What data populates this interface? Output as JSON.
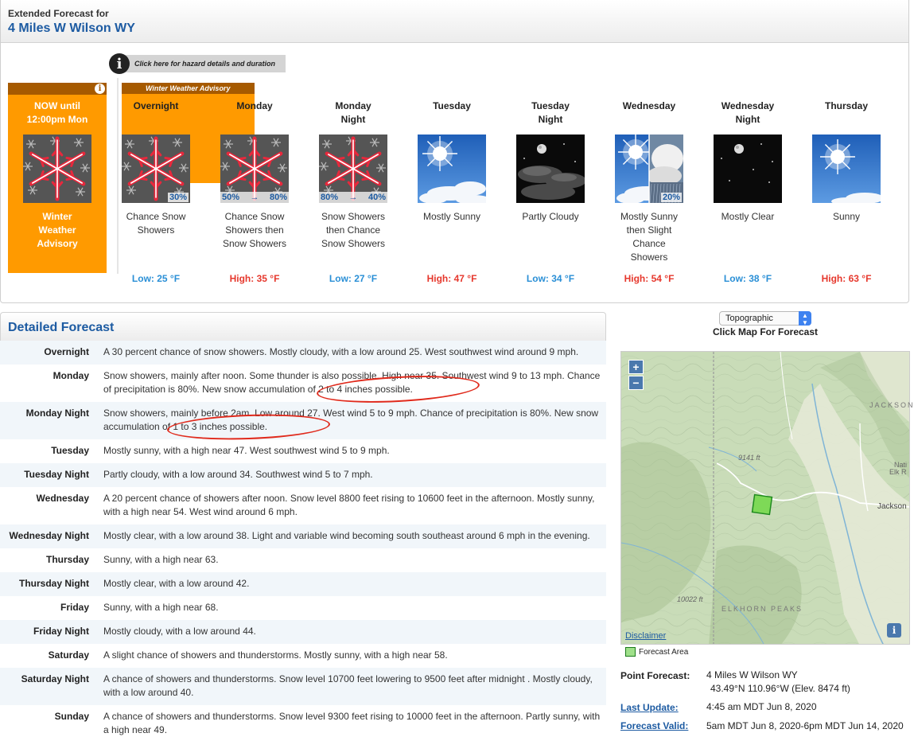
{
  "extended": {
    "title_small": "Extended Forecast for",
    "location": "4 Miles W Wilson WY",
    "hazard_link": "Click here for hazard details and duration",
    "hazard_icon": "info-icon",
    "now_label": "NOW until\n12:00pm Mon",
    "now_advisory": "Winter\nWeather\nAdvisory",
    "band_label": "Winter Weather Advisory",
    "periods": [
      {
        "name": "Overnight",
        "desc": "Chance Snow\nShowers",
        "temp": "Low: 25 °F",
        "kind": "low",
        "icon": "snow-icon",
        "pop_right": "30%",
        "pop_left": ""
      },
      {
        "name": "Monday",
        "desc": "Chance Snow\nShowers then\nSnow Showers",
        "temp": "High: 35 °F",
        "kind": "high",
        "icon": "snow-icon",
        "pop_left": "50%",
        "pop_right": "80%"
      },
      {
        "name": "Monday\nNight",
        "desc": "Snow Showers\nthen Chance\nSnow Showers",
        "temp": "Low: 27 °F",
        "kind": "low",
        "icon": "snow-icon",
        "pop_left": "80%",
        "pop_right": "40%"
      },
      {
        "name": "Tuesday",
        "desc": "Mostly Sunny",
        "temp": "High: 47 °F",
        "kind": "high",
        "icon": "mostly-sunny-icon",
        "pop_left": "",
        "pop_right": ""
      },
      {
        "name": "Tuesday\nNight",
        "desc": "Partly Cloudy",
        "temp": "Low: 34 °F",
        "kind": "low",
        "icon": "partly-cloudy-night-icon",
        "pop_left": "",
        "pop_right": ""
      },
      {
        "name": "Wednesday",
        "desc": "Mostly Sunny\nthen Slight\nChance\nShowers",
        "temp": "High: 54 °F",
        "kind": "high",
        "icon": "sunny-then-showers-icon",
        "pop_left": "",
        "pop_right": "20%"
      },
      {
        "name": "Wednesday\nNight",
        "desc": "Mostly Clear",
        "temp": "Low: 38 °F",
        "kind": "low",
        "icon": "mostly-clear-night-icon",
        "pop_left": "",
        "pop_right": ""
      },
      {
        "name": "Thursday",
        "desc": "Sunny",
        "temp": "High: 63 °F",
        "kind": "high",
        "icon": "sunny-icon",
        "pop_left": "",
        "pop_right": ""
      }
    ]
  },
  "detailed": {
    "title": "Detailed Forecast",
    "rows": [
      {
        "label": "Overnight",
        "text": "A 30 percent chance of snow showers. Mostly cloudy, with a low around 25. West southwest wind around 9 mph."
      },
      {
        "label": "Monday",
        "text": "Snow showers, mainly after noon. Some thunder is also possible. High near 35. Southwest wind 9 to 13 mph. Chance of precipitation is 80%. New snow accumulation of 2 to 4 inches possible."
      },
      {
        "label": "Monday Night",
        "text": "Snow showers, mainly before 2am. Low around 27. West wind 5 to 9 mph. Chance of precipitation is 80%. New snow accumulation of 1 to 3 inches possible."
      },
      {
        "label": "Tuesday",
        "text": "Mostly sunny, with a high near 47. West southwest wind 5 to 9 mph."
      },
      {
        "label": "Tuesday Night",
        "text": "Partly cloudy, with a low around 34. Southwest wind 5 to 7 mph."
      },
      {
        "label": "Wednesday",
        "text": "A 20 percent chance of showers after noon. Snow level 8800 feet rising to 10600 feet in the afternoon. Mostly sunny, with a high near 54. West wind around 6 mph."
      },
      {
        "label": "Wednesday Night",
        "text": "Mostly clear, with a low around 38. Light and variable wind becoming south southeast around 6 mph in the evening."
      },
      {
        "label": "Thursday",
        "text": "Sunny, with a high near 63."
      },
      {
        "label": "Thursday Night",
        "text": "Mostly clear, with a low around 42."
      },
      {
        "label": "Friday",
        "text": "Sunny, with a high near 68."
      },
      {
        "label": "Friday Night",
        "text": "Mostly cloudy, with a low around 44."
      },
      {
        "label": "Saturday",
        "text": "A slight chance of showers and thunderstorms. Mostly sunny, with a high near 58."
      },
      {
        "label": "Saturday Night",
        "text": "A chance of showers and thunderstorms. Snow level 10700 feet lowering to 9500 feet after midnight . Mostly cloudy, with a low around 40."
      },
      {
        "label": "Sunday",
        "text": "A chance of showers and thunderstorms. Snow level 9300 feet rising to 10000 feet in the afternoon. Partly sunny, with a high near 49."
      }
    ]
  },
  "map": {
    "select_value": "Topographic",
    "caption": "Click Map For Forecast",
    "zoom_in": "+",
    "zoom_out": "−",
    "info": "i",
    "disclaimer": "Disclaimer",
    "legend": "Forecast Area",
    "labels": {
      "jackson_caps": "JACKSON",
      "jackson": "Jackson",
      "elev_1": "9141 ft",
      "elev_2": "10022 ft",
      "elkhorn": "ELKHORN PEAKS",
      "nati": "Nati",
      "elk": "Elk R"
    }
  },
  "point_info": {
    "point_label": "Point Forecast:",
    "point_value": "4 Miles W Wilson WY",
    "point_coords": "43.49°N 110.96°W (Elev. 8474 ft)",
    "update_label": "Last Update:",
    "update_value": "4:45 am MDT Jun 8, 2020",
    "valid_label": "Forecast Valid:",
    "valid_value": "5am MDT Jun 8, 2020-6pm MDT Jun 14, 2020"
  },
  "colors": {
    "advisory": "#ff9a00",
    "advisory_dark": "#a65a00",
    "link": "#1d5ba2",
    "low": "#2a8fd6",
    "high": "#e6382d"
  }
}
